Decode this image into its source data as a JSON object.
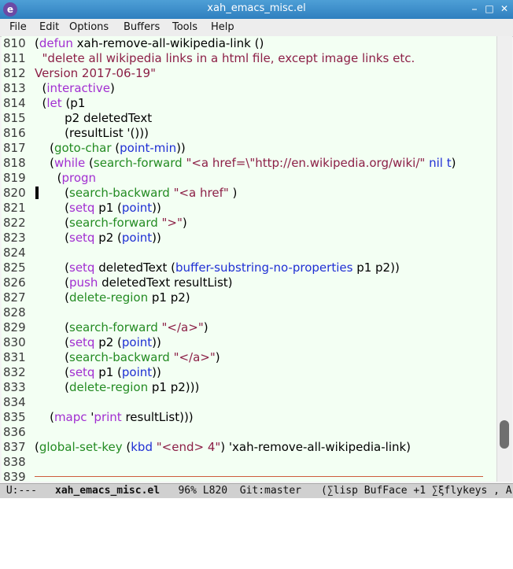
{
  "window": {
    "title": "xah_emacs_misc.el",
    "app_icon_glyph": "e",
    "controls": {
      "minimize": "⎯",
      "maximize": "□",
      "close": "✕"
    }
  },
  "menubar": {
    "items": [
      "File",
      "Edit",
      "Options",
      "Buffers",
      "Tools",
      "Help"
    ]
  },
  "editor": {
    "lines": [
      {
        "n": "810",
        "tokens": [
          [
            "(",
            ""
          ],
          [
            "defun",
            "kw"
          ],
          [
            " xah-remove-all-wikipedia-link ()",
            ""
          ]
        ]
      },
      {
        "n": "811",
        "tokens": [
          [
            "  \"delete all wikipedia links in a html file, except image links etc.",
            "str"
          ]
        ]
      },
      {
        "n": "812",
        "tokens": [
          [
            "Version 2017-06-19\"",
            "str"
          ]
        ]
      },
      {
        "n": "813",
        "tokens": [
          [
            "  (",
            ""
          ],
          [
            "interactive",
            "kw"
          ],
          [
            ")",
            ""
          ]
        ]
      },
      {
        "n": "814",
        "tokens": [
          [
            "  (",
            ""
          ],
          [
            "let",
            "kw"
          ],
          [
            " (p1",
            ""
          ]
        ]
      },
      {
        "n": "815",
        "tokens": [
          [
            "        p2 deletedText",
            ""
          ]
        ]
      },
      {
        "n": "816",
        "tokens": [
          [
            "        (resultList '()))",
            ""
          ]
        ]
      },
      {
        "n": "817",
        "tokens": [
          [
            "    (",
            ""
          ],
          [
            "goto-char",
            "fn"
          ],
          [
            " (",
            ""
          ],
          [
            "point-min",
            "bi"
          ],
          [
            "))",
            ""
          ]
        ]
      },
      {
        "n": "818",
        "tokens": [
          [
            "    (",
            ""
          ],
          [
            "while",
            "kw"
          ],
          [
            " (",
            ""
          ],
          [
            "search-forward",
            "fn"
          ],
          [
            " ",
            ""
          ],
          [
            "\"<a href=\\\"http://en.wikipedia.org/wiki/\"",
            "str"
          ],
          [
            " ",
            ""
          ],
          [
            "nil t",
            "bi"
          ],
          [
            ")",
            ""
          ]
        ]
      },
      {
        "n": "819",
        "tokens": [
          [
            "      (",
            ""
          ],
          [
            "progn",
            "kw"
          ]
        ]
      },
      {
        "n": "820",
        "tokens": [
          [
            "        (",
            ""
          ],
          [
            "search-backward",
            "fn"
          ],
          [
            " ",
            ""
          ],
          [
            "\"<a href\"",
            "str"
          ],
          [
            " )",
            ""
          ]
        ]
      },
      {
        "n": "821",
        "tokens": [
          [
            "        (",
            ""
          ],
          [
            "setq",
            "kw"
          ],
          [
            " p1 (",
            ""
          ],
          [
            "point",
            "bi"
          ],
          [
            "))",
            ""
          ]
        ]
      },
      {
        "n": "822",
        "tokens": [
          [
            "        (",
            ""
          ],
          [
            "search-forward",
            "fn"
          ],
          [
            " ",
            ""
          ],
          [
            "\">\"",
            "str"
          ],
          [
            ")",
            ""
          ]
        ]
      },
      {
        "n": "823",
        "tokens": [
          [
            "        (",
            ""
          ],
          [
            "setq",
            "kw"
          ],
          [
            " p2 (",
            ""
          ],
          [
            "point",
            "bi"
          ],
          [
            "))",
            ""
          ]
        ]
      },
      {
        "n": "824",
        "tokens": []
      },
      {
        "n": "825",
        "tokens": [
          [
            "        (",
            ""
          ],
          [
            "setq",
            "kw"
          ],
          [
            " deletedText (",
            ""
          ],
          [
            "buffer-substring-no-properties",
            "bi"
          ],
          [
            " p1 p2))",
            ""
          ]
        ]
      },
      {
        "n": "826",
        "tokens": [
          [
            "        (",
            ""
          ],
          [
            "push",
            "kw"
          ],
          [
            " deletedText resultList)",
            ""
          ]
        ]
      },
      {
        "n": "827",
        "tokens": [
          [
            "        (",
            ""
          ],
          [
            "delete-region",
            "fn"
          ],
          [
            " p1 p2)",
            ""
          ]
        ]
      },
      {
        "n": "828",
        "tokens": []
      },
      {
        "n": "829",
        "tokens": [
          [
            "        (",
            ""
          ],
          [
            "search-forward",
            "fn"
          ],
          [
            " ",
            ""
          ],
          [
            "\"</a>\"",
            "str"
          ],
          [
            ")",
            ""
          ]
        ]
      },
      {
        "n": "830",
        "tokens": [
          [
            "        (",
            ""
          ],
          [
            "setq",
            "kw"
          ],
          [
            " p2 (",
            ""
          ],
          [
            "point",
            "bi"
          ],
          [
            "))",
            ""
          ]
        ]
      },
      {
        "n": "831",
        "tokens": [
          [
            "        (",
            ""
          ],
          [
            "search-backward",
            "fn"
          ],
          [
            " ",
            ""
          ],
          [
            "\"</a>\"",
            "str"
          ],
          [
            ")",
            ""
          ]
        ]
      },
      {
        "n": "832",
        "tokens": [
          [
            "        (",
            ""
          ],
          [
            "setq",
            "kw"
          ],
          [
            " p1 (",
            ""
          ],
          [
            "point",
            "bi"
          ],
          [
            "))",
            ""
          ]
        ]
      },
      {
        "n": "833",
        "tokens": [
          [
            "        (",
            ""
          ],
          [
            "delete-region",
            "fn"
          ],
          [
            " p1 p2)))",
            ""
          ]
        ]
      },
      {
        "n": "834",
        "tokens": []
      },
      {
        "n": "835",
        "tokens": [
          [
            "    (",
            ""
          ],
          [
            "mapc",
            "kw"
          ],
          [
            " '",
            ""
          ],
          [
            "print",
            "kw"
          ],
          [
            " resultList)))",
            ""
          ]
        ]
      },
      {
        "n": "836",
        "tokens": []
      },
      {
        "n": "837",
        "tokens": [
          [
            "(",
            ""
          ],
          [
            "global-set-key",
            "fn"
          ],
          [
            " (",
            ""
          ],
          [
            "kbd",
            "bi"
          ],
          [
            " ",
            ""
          ],
          [
            "\"<end> 4\"",
            "str"
          ],
          [
            ") 'xah-remove-all-wikipedia-link)",
            ""
          ]
        ]
      },
      {
        "n": "838",
        "tokens": []
      },
      {
        "n": "839",
        "tokens": []
      }
    ],
    "wrap_indicator": "↩"
  },
  "modeline": {
    "status": " U:---  ",
    "buffer_name": "xah_emacs_misc.el",
    "position": "   96% L820  Git:master  ",
    "modes": "(∑lisp BufFace +1 ∑ξflykeys , A"
  },
  "colors": {
    "keyword": "#a12ed1",
    "function": "#238b22",
    "builtin": "#1f2fd4",
    "string": "#8c1f46",
    "editor_bg": "#f3fff3",
    "fill_column_rule": "#cd5c3c"
  }
}
